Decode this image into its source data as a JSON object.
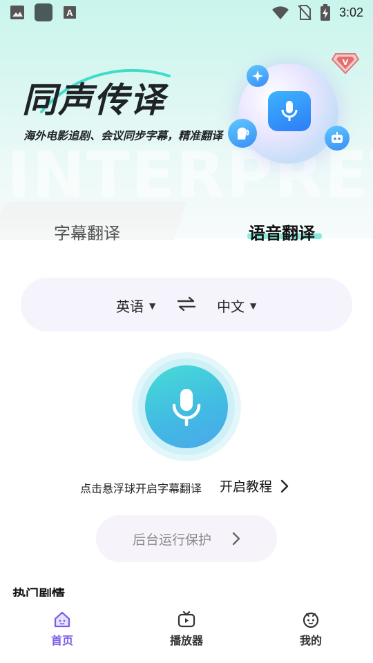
{
  "status_bar": {
    "time": "3:02",
    "icons": [
      "image-icon",
      "app-square-icon",
      "font-a-icon",
      "wifi-icon",
      "no-sim-icon",
      "battery-charging-icon"
    ]
  },
  "hero": {
    "title": "同声传译",
    "subtitle": "海外电影追剧、会议同步字幕，精准翻译",
    "watermark": "INTERPRET",
    "badge_icon": "vip-diamond-icon",
    "orb_icons": [
      "sparkle-icon",
      "microphone-icon",
      "speaking-head-icon",
      "robot-icon"
    ]
  },
  "tabs": [
    {
      "label": "字幕翻译",
      "active": false
    },
    {
      "label": "语音翻译",
      "active": true
    }
  ],
  "language": {
    "source": "英语",
    "target": "中文",
    "swap_icon": "swap-arrows-icon",
    "dropdown_icon": "caret-down-icon"
  },
  "mic": {
    "icon": "microphone-icon"
  },
  "hint": {
    "text": "点击悬浮球开启字幕翻译",
    "link": "开启教程"
  },
  "background_protect": {
    "label": "后台运行保护"
  },
  "section": {
    "title": "热门剧情"
  },
  "bottom_nav": [
    {
      "label": "首页",
      "icon": "home-icon",
      "active": true
    },
    {
      "label": "播放器",
      "icon": "tv-play-icon",
      "active": false
    },
    {
      "label": "我的",
      "icon": "profile-face-icon",
      "active": false
    }
  ],
  "colors": {
    "accent_teal": "#46dcd5",
    "accent_blue": "#42b9e4",
    "nav_active": "#7b5ce6",
    "underline": "#7ee8d9",
    "pill_bg": "#f5f3fb"
  }
}
